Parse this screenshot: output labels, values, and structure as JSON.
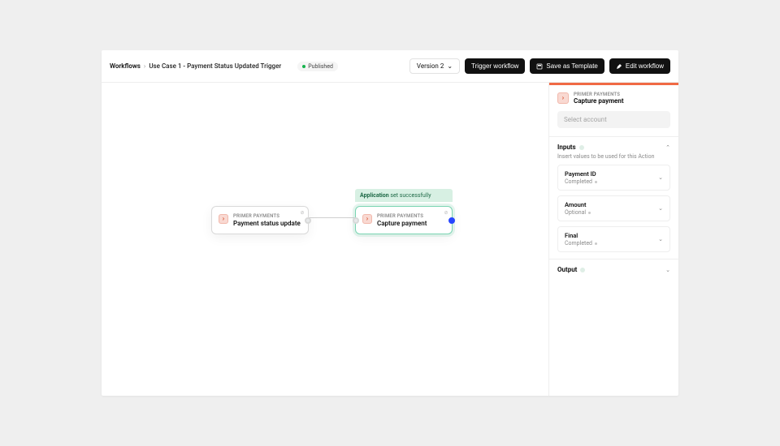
{
  "breadcrumbs": {
    "root": "Workflows",
    "page": "Use Case 1 - Payment Status Updated Trigger"
  },
  "status_badge": "Published",
  "version_selector": {
    "label": "Version 2"
  },
  "actions": {
    "trigger": "Trigger workflow",
    "save_template": "Save as Template",
    "edit": "Edit workflow"
  },
  "canvas": {
    "tooltip_strong": "Application",
    "tooltip_rest": " set successfully",
    "nodes": [
      {
        "id": "a",
        "overline": "PRIMER PAYMENTS",
        "title": "Payment status update"
      },
      {
        "id": "b",
        "overline": "PRIMER PAYMENTS",
        "title": "Capture payment"
      }
    ]
  },
  "panel": {
    "overline": "PRIMER PAYMENTS",
    "title": "Capture payment",
    "account_placeholder": "Select account",
    "inputs": {
      "title": "Inputs",
      "subtitle": "Insert values to be used for this Action",
      "fields": [
        {
          "label": "Payment ID",
          "status": "Completed"
        },
        {
          "label": "Amount",
          "status": "Optional"
        },
        {
          "label": "Final",
          "status": "Completed"
        }
      ]
    },
    "output": {
      "title": "Output"
    }
  }
}
